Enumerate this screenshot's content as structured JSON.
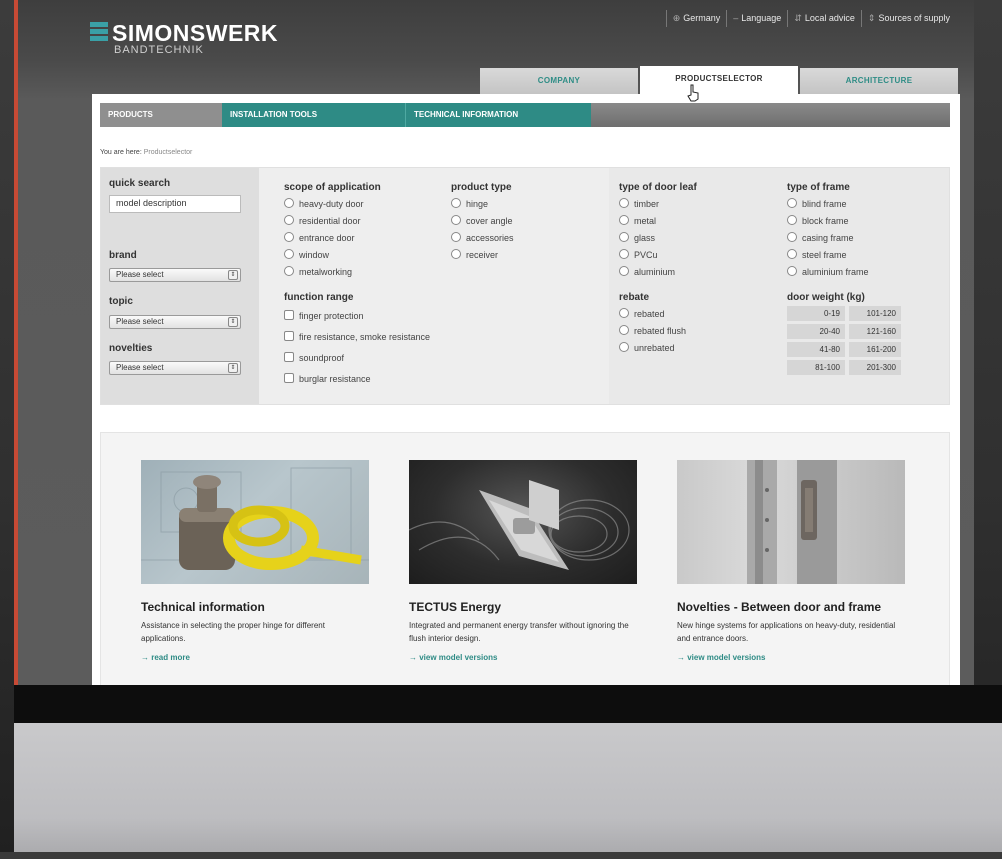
{
  "header": {
    "logo_name": "SIMONSWERK",
    "logo_sub": "BANDTECHNIK",
    "util": [
      {
        "icon": "globe-icon",
        "label": "Germany"
      },
      {
        "icon": "dash-icon",
        "label": "Language"
      },
      {
        "icon": "arrows-icon",
        "label": "Local advice"
      },
      {
        "icon": "sort-icon",
        "label": "Sources of supply"
      }
    ],
    "main_tabs": [
      "COMPANY",
      "PRODUCTSELECTOR",
      "ARCHITECTURE"
    ]
  },
  "subnav": [
    "PRODUCTS",
    "INSTALLATION TOOLS",
    "TECHNICAL INFORMATION"
  ],
  "breadcrumb": {
    "prefix": "You are here:",
    "current": "Productselector"
  },
  "quick_search": {
    "title": "quick search",
    "input_value": "model description",
    "brand_label": "brand",
    "brand_value": "Please select",
    "topic_label": "topic",
    "topic_value": "Please select",
    "novelties_label": "novelties",
    "novelties_value": "Please select"
  },
  "scope": {
    "title": "scope of application",
    "options": [
      "heavy-duty door",
      "residential door",
      "entrance door",
      "window",
      "metalworking"
    ]
  },
  "product_type": {
    "title": "product type",
    "options": [
      "hinge",
      "cover angle",
      "accessories",
      "receiver"
    ]
  },
  "function_range": {
    "title": "function range",
    "options": [
      "finger protection",
      "fire resistance, smoke resistance",
      "soundproof",
      "burglar resistance"
    ]
  },
  "door_leaf": {
    "title": "type of door leaf",
    "options": [
      "timber",
      "metal",
      "glass",
      "PVCu",
      "aluminium"
    ]
  },
  "rebate": {
    "title": "rebate",
    "options": [
      "rebated",
      "rebated flush",
      "unrebated"
    ]
  },
  "frame": {
    "title": "type of frame",
    "options": [
      "blind frame",
      "block frame",
      "casing frame",
      "steel frame",
      "aluminium frame"
    ]
  },
  "door_weight": {
    "title": "door weight (kg)",
    "options": [
      "0-19",
      "101-120",
      "20-40",
      "121-160",
      "41-80",
      "161-200",
      "81-100",
      "201-300"
    ]
  },
  "cards": [
    {
      "title": "Technical information",
      "text": "Assistance in selecting the proper hinge for different applications.",
      "link": "→ read more"
    },
    {
      "title": "TECTUS Energy",
      "text": "Integrated and permanent energy transfer without ignoring the flush interior design.",
      "link": "→ view model versions"
    },
    {
      "title": "Novelties - Between door and frame",
      "text": "New hinge systems for applications on heavy-duty, residential and entrance doors.",
      "link": "→ view model versions"
    }
  ],
  "colors": {
    "teal": "#2e8b85",
    "logo_accent": "#3aa0a6",
    "edge": "#c74a35"
  }
}
